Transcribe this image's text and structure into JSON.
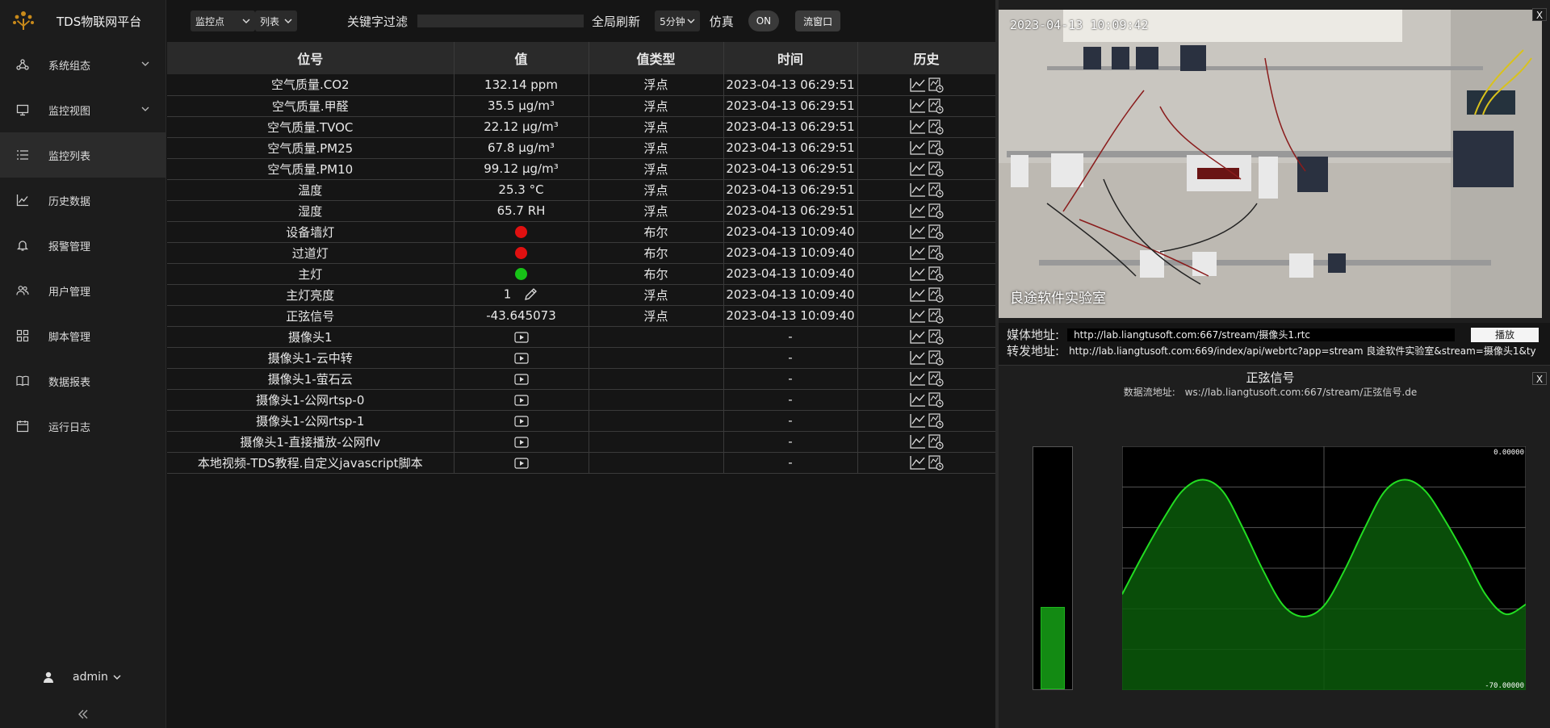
{
  "app": {
    "title": "TDS物联网平台"
  },
  "sidebar": {
    "items": [
      {
        "label": "系统组态",
        "icon": "topology-icon",
        "has_submenu": true,
        "active": false
      },
      {
        "label": "监控视图",
        "icon": "monitor-icon",
        "has_submenu": true,
        "active": false
      },
      {
        "label": "监控列表",
        "icon": "list-icon",
        "has_submenu": false,
        "active": true
      },
      {
        "label": "历史数据",
        "icon": "line-chart-icon",
        "has_submenu": false,
        "active": false
      },
      {
        "label": "报警管理",
        "icon": "bell-icon",
        "has_submenu": false,
        "active": false
      },
      {
        "label": "用户管理",
        "icon": "users-icon",
        "has_submenu": false,
        "active": false
      },
      {
        "label": "脚本管理",
        "icon": "grid-icon",
        "has_submenu": false,
        "active": false
      },
      {
        "label": "数据报表",
        "icon": "book-icon",
        "has_submenu": false,
        "active": false
      },
      {
        "label": "运行日志",
        "icon": "calendar-icon",
        "has_submenu": false,
        "active": false
      }
    ],
    "user": "admin"
  },
  "toolbar": {
    "scope_select": "监控点",
    "view_select": "列表",
    "filter_label": "关键字过滤",
    "filter_value": "",
    "refresh_label": "全局刷新",
    "refresh_select": "5分钟",
    "sim_label": "仿真",
    "sim_toggle": "ON",
    "stream_window_button": "流窗口"
  },
  "table": {
    "headers": [
      "位号",
      "值",
      "值类型",
      "时间",
      "历史"
    ],
    "rows": [
      {
        "tag": "空气质量.CO2",
        "value": "132.14 ppm",
        "kind": "text",
        "type": "浮点",
        "time": "2023-04-13 06:29:51"
      },
      {
        "tag": "空气质量.甲醛",
        "value": "35.5 μg/m³",
        "kind": "text",
        "type": "浮点",
        "time": "2023-04-13 06:29:51"
      },
      {
        "tag": "空气质量.TVOC",
        "value": "22.12 μg/m³",
        "kind": "text",
        "type": "浮点",
        "time": "2023-04-13 06:29:51"
      },
      {
        "tag": "空气质量.PM25",
        "value": "67.8 μg/m³",
        "kind": "text",
        "type": "浮点",
        "time": "2023-04-13 06:29:51"
      },
      {
        "tag": "空气质量.PM10",
        "value": "99.12 μg/m³",
        "kind": "text",
        "type": "浮点",
        "time": "2023-04-13 06:29:51"
      },
      {
        "tag": "温度",
        "value": "25.3 °C",
        "kind": "text",
        "type": "浮点",
        "time": "2023-04-13 06:29:51"
      },
      {
        "tag": "湿度",
        "value": "65.7 RH",
        "kind": "text",
        "type": "浮点",
        "time": "2023-04-13 06:29:51"
      },
      {
        "tag": "设备墙灯",
        "value": "",
        "kind": "dot",
        "color": "#e01010",
        "type": "布尔",
        "time": "2023-04-13 10:09:40"
      },
      {
        "tag": "过道灯",
        "value": "",
        "kind": "dot",
        "color": "#e01010",
        "type": "布尔",
        "time": "2023-04-13 10:09:40"
      },
      {
        "tag": "主灯",
        "value": "",
        "kind": "dot",
        "color": "#17c217",
        "type": "布尔",
        "time": "2023-04-13 10:09:40"
      },
      {
        "tag": "主灯亮度",
        "value": "1",
        "kind": "edit",
        "type": "浮点",
        "time": "2023-04-13 10:09:40"
      },
      {
        "tag": "正弦信号",
        "value": "-43.645073",
        "kind": "text",
        "type": "浮点",
        "time": "2023-04-13 10:09:40"
      },
      {
        "tag": "摄像头1",
        "value": "",
        "kind": "play",
        "type": "",
        "time": "-"
      },
      {
        "tag": "摄像头1-云中转",
        "value": "",
        "kind": "play",
        "type": "",
        "time": "-"
      },
      {
        "tag": "摄像头1-萤石云",
        "value": "",
        "kind": "play",
        "type": "",
        "time": "-"
      },
      {
        "tag": "摄像头1-公网rtsp-0",
        "value": "",
        "kind": "play",
        "type": "",
        "time": "-"
      },
      {
        "tag": "摄像头1-公网rtsp-1",
        "value": "",
        "kind": "play",
        "type": "",
        "time": "-"
      },
      {
        "tag": "摄像头1-直接播放-公网flv",
        "value": "",
        "kind": "play",
        "type": "",
        "time": "-"
      },
      {
        "tag": "本地视频-TDS教程.自定义javascript脚本",
        "value": "",
        "kind": "play",
        "type": "",
        "time": "-"
      }
    ]
  },
  "video": {
    "close": "X",
    "timestamp": "2023-04-13 10:09:42",
    "caption": "良途软件实验室",
    "media_label": "媒体地址:",
    "media_url": "http://lab.liangtusoft.com:667/stream/摄像头1.rtc",
    "play_button": "播放",
    "forward_label": "转发地址:",
    "forward_url": "http://lab.liangtusoft.com:669/index/api/webrtc?app=stream  良途软件实验室&stream=摄像头1&ty"
  },
  "chart": {
    "close": "X",
    "title": "正弦信号",
    "stream_label": "数据流地址:",
    "stream_url": "ws://lab.liangtusoft.com:667/stream/正弦信号.de"
  },
  "chart_data": {
    "type": "area",
    "title": "正弦信号",
    "ylim": [
      -70.0,
      0.0
    ],
    "ytick_labels": [
      "0.00000",
      "-70.00000"
    ],
    "grid": true,
    "color": "#22dd22",
    "fill": "#0b5a0b",
    "x": [
      0,
      0.05,
      0.1,
      0.15,
      0.2,
      0.25,
      0.3,
      0.35,
      0.4,
      0.45,
      0.5,
      0.55,
      0.6,
      0.65,
      0.7,
      0.75,
      0.8,
      0.85,
      0.9,
      0.95,
      1.0
    ],
    "y": [
      -42.5,
      -31.5,
      -21.3,
      -12.7,
      -9.6,
      -13.0,
      -23.7,
      -35.8,
      -45.8,
      -48.9,
      -45.8,
      -35.8,
      -23.7,
      -13.0,
      -9.6,
      -12.7,
      -21.3,
      -31.5,
      -42.5,
      -48.2,
      -45.4
    ],
    "level_bar": {
      "value": -43.645073,
      "min": -70.0,
      "max": 0.0
    }
  }
}
